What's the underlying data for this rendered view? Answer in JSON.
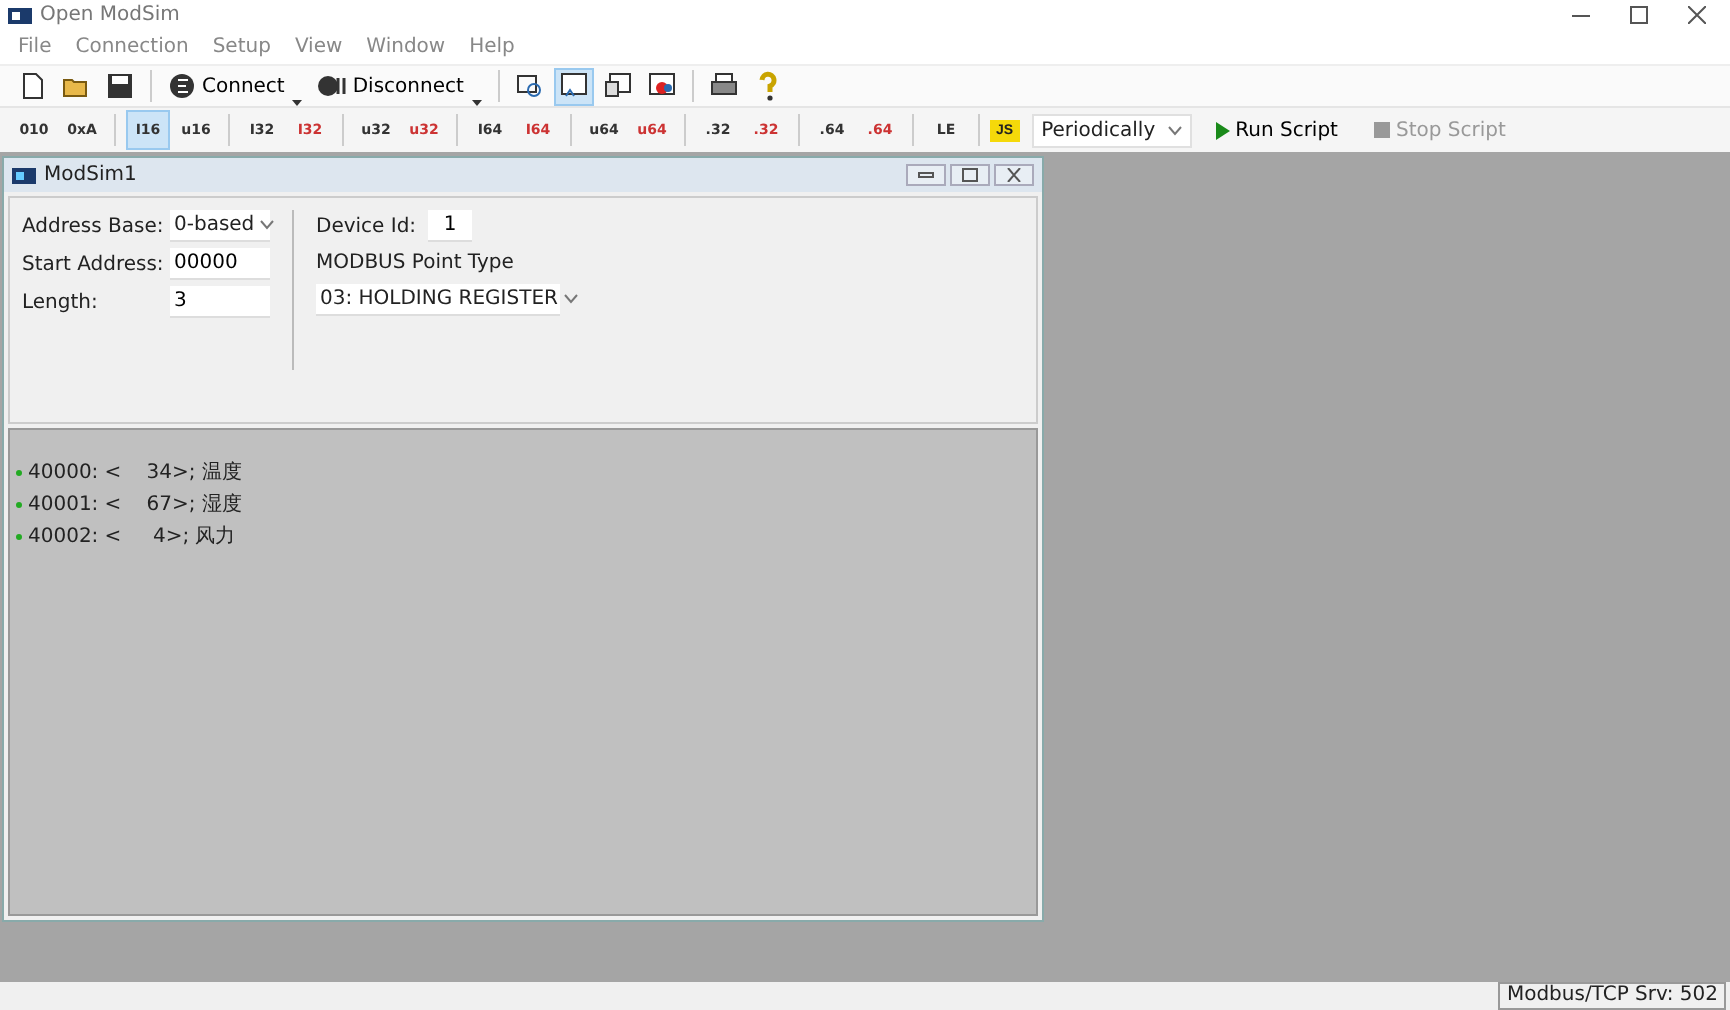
{
  "window": {
    "title": "Open ModSim"
  },
  "menu": [
    "File",
    "Connection",
    "Setup",
    "View",
    "Window",
    "Help"
  ],
  "toolbar": [
    {
      "kind": "icon",
      "selected": false
    },
    {
      "kind": "icon",
      "selected": false
    },
    {
      "kind": "icon",
      "selected": false
    },
    {
      "kind": "sep"
    },
    {
      "kind": "split",
      "label": "Connect"
    },
    {
      "kind": "split",
      "label": "Disconnect"
    },
    {
      "kind": "sep"
    },
    {
      "kind": "icon",
      "selected": false
    },
    {
      "kind": "icon",
      "selected": true
    },
    {
      "kind": "icon",
      "selected": false
    },
    {
      "kind": "icon",
      "selected": false
    },
    {
      "kind": "sep"
    },
    {
      "kind": "icon",
      "selected": false
    },
    {
      "kind": "icon",
      "selected": false
    }
  ],
  "format_toolbar": [
    {
      "label": "010",
      "swapped": false,
      "selected": false
    },
    {
      "label": "0xA",
      "swapped": false,
      "selected": false
    },
    {
      "label": "I16",
      "swapped": false,
      "selected": true
    },
    {
      "label": "u16",
      "swapped": false,
      "selected": false
    },
    {
      "label": "I32",
      "swapped": false,
      "selected": false
    },
    {
      "label": "I32",
      "swapped": true,
      "selected": false
    },
    {
      "label": "u32",
      "swapped": false,
      "selected": false
    },
    {
      "label": "u32",
      "swapped": true,
      "selected": false
    },
    {
      "label": "I64",
      "swapped": false,
      "selected": false
    },
    {
      "label": "I64",
      "swapped": true,
      "selected": false
    },
    {
      "label": "u64",
      "swapped": false,
      "selected": false
    },
    {
      "label": "u64",
      "swapped": true,
      "selected": false
    },
    {
      "label": ".32",
      "swapped": false,
      "selected": false
    },
    {
      "label": ".32",
      "swapped": true,
      "selected": false
    },
    {
      "label": ".64",
      "swapped": false,
      "selected": false
    },
    {
      "label": ".64",
      "swapped": true,
      "selected": false
    },
    {
      "label": "LE",
      "swapped": false,
      "selected": false
    }
  ],
  "script_bar": {
    "badge": "JS",
    "mode": "Periodically",
    "run": {
      "label": "Run Script",
      "disabled": false
    },
    "stop": {
      "label": "Stop Script",
      "disabled": true
    }
  },
  "child": {
    "title": "ModSim1",
    "address_base": {
      "label": "Address Base:",
      "value": "0-based"
    },
    "start_address": {
      "label": "Start Address:",
      "value": "00000"
    },
    "length": {
      "label": "Length:",
      "value": "3"
    },
    "device_id": {
      "label": "Device Id:",
      "value": "1"
    },
    "point_type": {
      "label": "MODBUS Point Type",
      "value": "03: HOLDING REGISTER"
    },
    "registers": [
      {
        "address": "40000:",
        "value": "<    34>;",
        "name": "温度",
        "color": "#22aa22"
      },
      {
        "address": "40001:",
        "value": "<    67>;",
        "name": "湿度",
        "color": "#22aa22"
      },
      {
        "address": "40002:",
        "value": "<     4>;",
        "name": "风力",
        "color": "#22aa22"
      }
    ]
  },
  "status_bar": {
    "text": "Modbus/TCP Srv: 502"
  }
}
